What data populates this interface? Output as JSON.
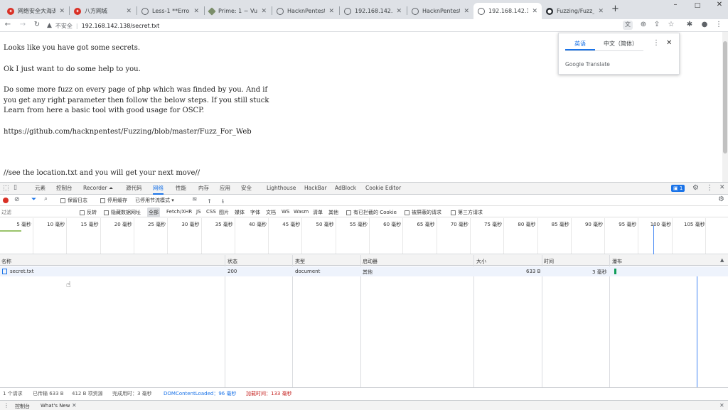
{
  "tabs": [
    {
      "label": "网络安全大海课",
      "icon_color": "#d93025",
      "icon": "shield-icon"
    },
    {
      "label": "八方网城",
      "icon_color": "#d93025",
      "icon": "shield-icon"
    },
    {
      "label": "Less-1 **Error",
      "icon_color": "#5f6368",
      "icon": "globe-icon"
    },
    {
      "label": "Prime: 1 ~ Vul",
      "icon_color": "#7b8e6a",
      "icon": "diamond-icon"
    },
    {
      "label": "HacknPentest",
      "icon_color": "#5f6368",
      "icon": "globe-icon"
    },
    {
      "label": "192.168.142.1",
      "icon_color": "#5f6368",
      "icon": "globe-icon"
    },
    {
      "label": "HacknPentest",
      "icon_color": "#5f6368",
      "icon": "globe-icon"
    },
    {
      "label": "192.168.142.1",
      "icon_color": "#5f6368",
      "icon": "globe-icon"
    },
    {
      "label": "Fuzzing/Fuzz_",
      "icon_color": "#24292f",
      "icon": "github-icon"
    }
  ],
  "window": {
    "minimize": "–",
    "maximize": "□",
    "close": "✕",
    "new_tab": "+"
  },
  "omnibox": {
    "security": "不安全",
    "url": "192.168.142.138/secret.txt"
  },
  "page": {
    "lines": [
      "Looks like you have got some secrets.",
      "Ok I just want to do some help to you.",
      "Do some more fuzz on every page of php which was finded by you. And if",
      "you get any right parameter then follow the below steps. If you still stuck",
      "Learn from here a basic tool with good usage for OSCP.",
      "https://github.com/hacknpentest/Fuzzing/blob/master/Fuzz_For_Web",
      "//see the location.txt and you will get your next move//"
    ]
  },
  "translate": {
    "lang_source": "英语",
    "lang_target": "中文（简体）",
    "brand": "Google Translate",
    "accent": "#1a73e8"
  },
  "devtools": {
    "tabs": [
      "元素",
      "控制台",
      "Recorder ⏶",
      "源代码",
      "网络",
      "性能",
      "内存",
      "应用",
      "安全",
      "Lighthouse",
      "HackBar",
      "AdBlock",
      "Cookie Editor"
    ],
    "active_tab": "网络",
    "issue_count": "1",
    "net_toolbar": {
      "preserve_log": "保留日志",
      "disable_cache": "停用缓存",
      "throttle": "已停用节流模式"
    },
    "filter": {
      "placeholder": "过滤",
      "invert": "反转",
      "hide_data_urls": "隐藏数据网址",
      "types": [
        "全部",
        "Fetch/XHR",
        "JS",
        "CSS",
        "图片",
        "媒体",
        "字体",
        "文档",
        "WS",
        "Wasm",
        "清单",
        "其他"
      ],
      "blocked_cookies": "有已拦截的 Cookie",
      "blocked_requests": "被屏蔽的请求",
      "third_party": "第三方请求"
    },
    "timeline_ticks": [
      "5 毫秒",
      "10 毫秒",
      "15 毫秒",
      "20 毫秒",
      "25 毫秒",
      "30 毫秒",
      "35 毫秒",
      "40 毫秒",
      "45 毫秒",
      "50 毫秒",
      "55 毫秒",
      "60 毫秒",
      "65 毫秒",
      "70 毫秒",
      "75 毫秒",
      "80 毫秒",
      "85 毫秒",
      "90 毫秒",
      "95 毫秒",
      "100 毫秒",
      "105 毫秒",
      "110"
    ],
    "columns": [
      "名称",
      "状态",
      "类型",
      "启动器",
      "大小",
      "时间",
      "瀑布"
    ],
    "rows": [
      {
        "name": "secret.txt",
        "status": "200",
        "type": "document",
        "initiator": "其他",
        "size": "633 B",
        "time": "3 毫秒"
      }
    ],
    "status_bar": {
      "requests": "1 个请求",
      "transferred": "已传输 633 B",
      "resources": "412 B 项资源",
      "finish": "完成用时：3 毫秒",
      "dcl": "DOMContentLoaded：96 毫秒",
      "load": "加载时间：133 毫秒"
    },
    "drawer_tabs": [
      "控制台",
      "What's New"
    ]
  }
}
